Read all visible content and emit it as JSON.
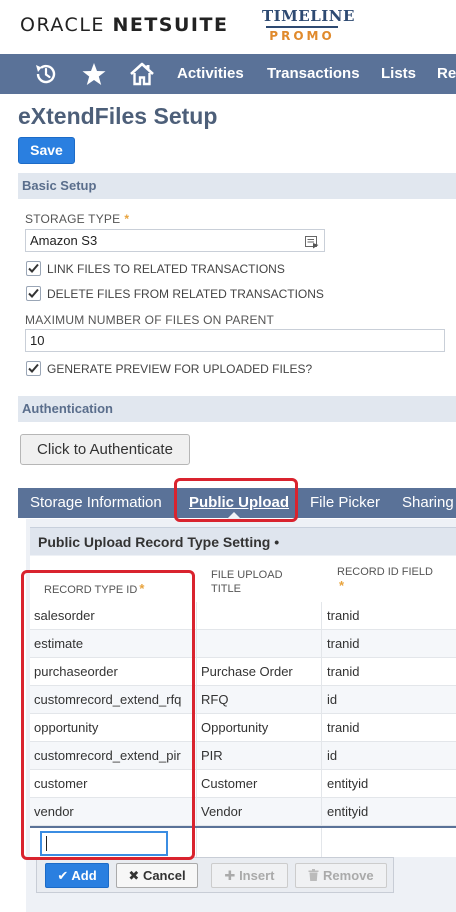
{
  "brand": {
    "oracle_text": "ORACLE",
    "netsuite_text": "NETSUITE",
    "partner_top": "TIMELINE",
    "partner_bottom": "PROMO"
  },
  "nav": {
    "links": [
      "Activities",
      "Transactions",
      "Lists",
      "Re"
    ],
    "icons": [
      "recent-records-icon",
      "star-icon",
      "home-icon"
    ]
  },
  "page": {
    "title": "eXtendFiles Setup",
    "save_label": "Save"
  },
  "basic_setup": {
    "heading": "Basic Setup",
    "storage_type_label": "STORAGE TYPE",
    "storage_type_value": "Amazon S3",
    "link_files_label": "LINK FILES TO RELATED TRANSACTIONS",
    "delete_files_label": "DELETE FILES FROM RELATED TRANSACTIONS",
    "max_files_label": "MAXIMUM NUMBER OF FILES ON PARENT",
    "max_files_value": "10",
    "generate_preview_label": "GENERATE PREVIEW FOR UPLOADED FILES?"
  },
  "authentication": {
    "heading": "Authentication",
    "button_label": "Click to Authenticate"
  },
  "tabs": [
    {
      "label": "Storage Information",
      "active": false
    },
    {
      "label": "Public Upload",
      "active": true
    },
    {
      "label": "File Picker",
      "active": false
    },
    {
      "label": "Sharing",
      "active": false
    }
  ],
  "public_upload": {
    "subheading": "Public Upload Record Type Setting",
    "columns": [
      "RECORD TYPE ID",
      "FILE UPLOAD TITLE",
      "RECORD ID FIELD"
    ],
    "rows": [
      [
        "salesorder",
        "",
        "tranid"
      ],
      [
        "estimate",
        "",
        "tranid"
      ],
      [
        "purchaseorder",
        "Purchase Order",
        "tranid"
      ],
      [
        "customrecord_extend_rfq",
        "RFQ",
        "id"
      ],
      [
        "opportunity",
        "Opportunity",
        "tranid"
      ],
      [
        "customrecord_extend_pir",
        "PIR",
        "id"
      ],
      [
        "customer",
        "Customer",
        "entityid"
      ],
      [
        "vendor",
        "Vendor",
        "entityid"
      ]
    ],
    "buttons": {
      "add": "Add",
      "cancel": "Cancel",
      "insert": "Insert",
      "remove": "Remove"
    }
  },
  "colors": {
    "nav_bg": "#5a7298",
    "primary_button": "#2a7fe0",
    "highlight": "#d9232e",
    "required_star": "#e8a33d"
  }
}
